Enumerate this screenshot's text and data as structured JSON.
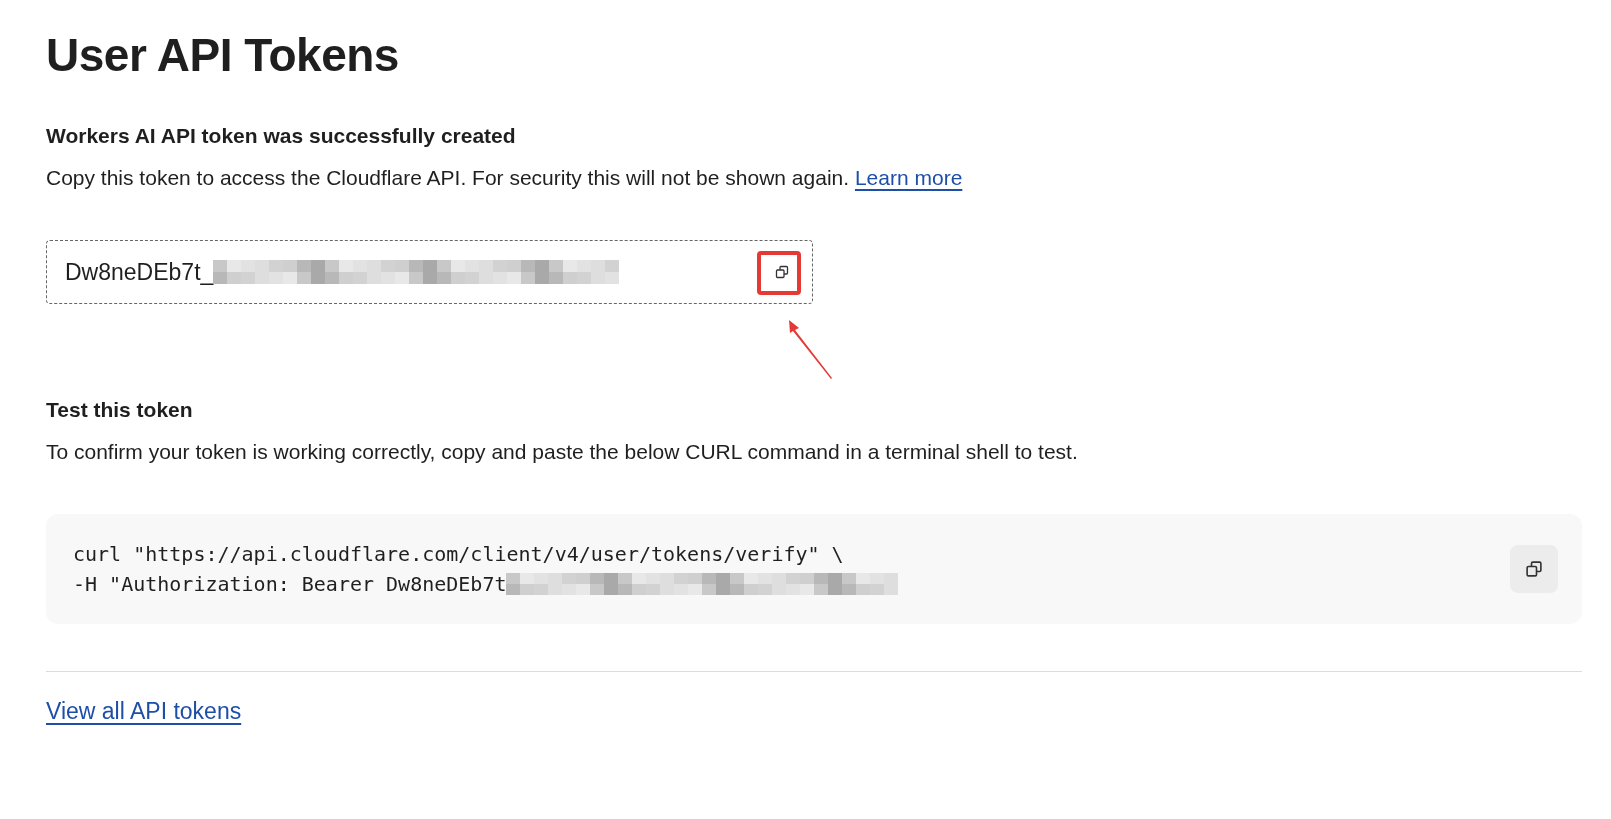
{
  "page_title": "User API Tokens",
  "created": {
    "heading": "Workers AI API token was successfully created",
    "text": "Copy this token to access the Cloudflare API. For security this will not be shown again.",
    "link": "Learn more"
  },
  "token_field": {
    "value": "Dw8neDEb7t_"
  },
  "test": {
    "heading": "Test this token",
    "text": "To confirm your token is working correctly, copy and paste the below CURL command in a terminal shell to test.",
    "code_lines": [
      "curl \"https://api.cloudflare.com/client/v4/user/tokens/verify\" \\",
      "-H \"Authorization: Bearer Dw8neDEb7t"
    ]
  },
  "footer_link": "View all API tokens"
}
